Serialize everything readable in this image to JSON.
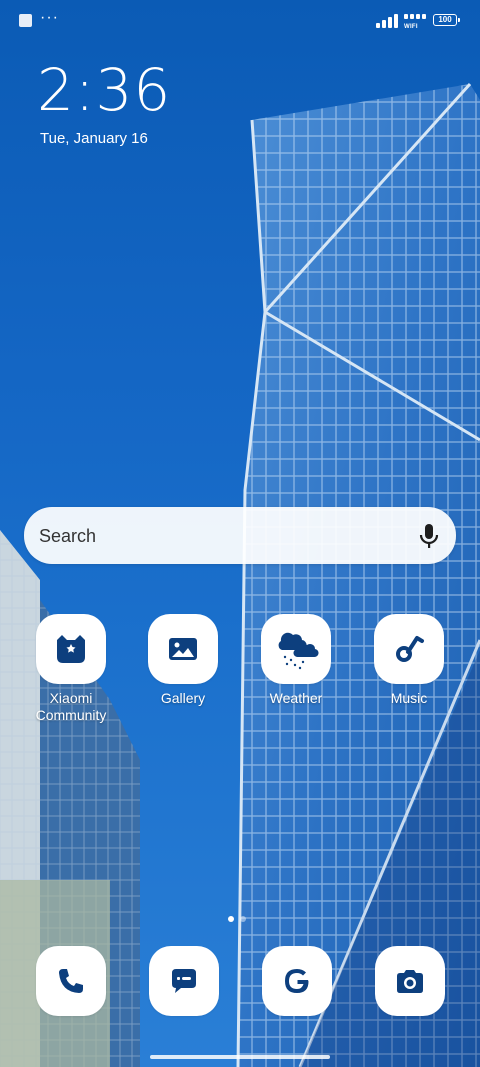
{
  "status_bar": {
    "dots": "···",
    "wifi_label": "WIFI",
    "battery_level": "100"
  },
  "clock": {
    "time": "2:36",
    "date": "Tue, January 16"
  },
  "search": {
    "placeholder": "Search"
  },
  "apps": [
    {
      "label": "Xiaomi\nCommunity",
      "icon": "xiaomi-community-icon"
    },
    {
      "label": "Gallery",
      "icon": "gallery-icon"
    },
    {
      "label": "Weather",
      "icon": "weather-icon"
    },
    {
      "label": "Music",
      "icon": "music-icon"
    }
  ],
  "dock": [
    {
      "icon": "phone-icon"
    },
    {
      "icon": "messages-icon"
    },
    {
      "icon": "google-icon"
    },
    {
      "icon": "camera-icon"
    }
  ],
  "pages": {
    "count": 2,
    "active": 1
  },
  "colors": {
    "icon_glyph": "#0d3f7e",
    "wallpaper_sky": "#0b5bb5"
  }
}
